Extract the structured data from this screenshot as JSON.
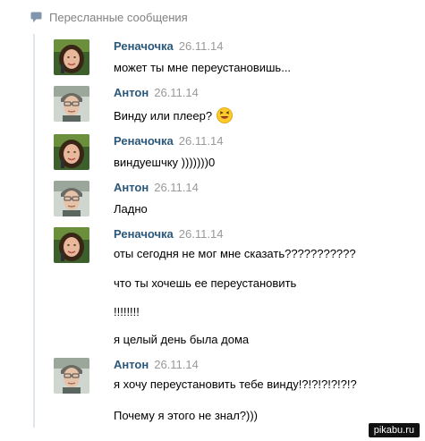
{
  "header": {
    "label": "Пересланные сообщения",
    "icon": "forward-message-icon"
  },
  "messages": [
    {
      "author": "Реначочка",
      "date": "26.11.14",
      "avatar": "avatar-renachochka",
      "lines": [
        "может ты мне переустановишь..."
      ]
    },
    {
      "author": "Антон",
      "date": "26.11.14",
      "avatar": "avatar-anton",
      "lines": [
        "Винду или плеер?"
      ],
      "emoji": "laughing-smiley-icon"
    },
    {
      "author": "Реначочка",
      "date": "26.11.14",
      "avatar": "avatar-renachochka",
      "lines": [
        "виндуешчку )))))))0"
      ]
    },
    {
      "author": "Антон",
      "date": "26.11.14",
      "avatar": "avatar-anton",
      "lines": [
        "Ладно"
      ]
    },
    {
      "author": "Реначочка",
      "date": "26.11.14",
      "avatar": "avatar-renachochka",
      "lines": [
        "оты сегодня не мог мне сказать???????????",
        "что ты хочешь ее переустановить",
        "!!!!!!!!",
        "я целый день была дома"
      ]
    },
    {
      "author": "Антон",
      "date": "26.11.14",
      "avatar": "avatar-anton",
      "lines": [
        "я хочу переустановить тебе винду!?!?!?!?!?!?",
        "Почему я этого не знал?)))"
      ]
    }
  ],
  "watermark": "pikabu.ru",
  "colors": {
    "author": "#2b587a",
    "date": "#999999",
    "header": "#828282",
    "thread_line": "#dfe6ee"
  }
}
